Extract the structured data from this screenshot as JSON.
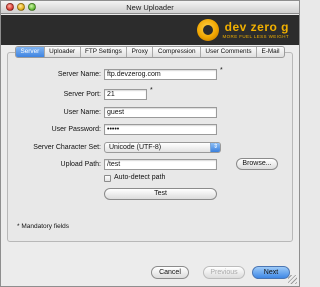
{
  "window": {
    "title": "New Uploader"
  },
  "banner": {
    "brand": "dev zero g",
    "tagline": "MORE FUEL LESS WEIGHT",
    "colors": {
      "background": "#2c2c2c",
      "accent": "#f1b000"
    }
  },
  "tabs": [
    {
      "label": "Server",
      "active": true
    },
    {
      "label": "Uploader",
      "active": false
    },
    {
      "label": "FTP Settings",
      "active": false
    },
    {
      "label": "Proxy",
      "active": false
    },
    {
      "label": "Compression",
      "active": false
    },
    {
      "label": "User Comments",
      "active": false
    },
    {
      "label": "E-Mail",
      "active": false
    }
  ],
  "form": {
    "server_name": {
      "label": "Server Name:",
      "value": "ftp.devzerog.com",
      "required_mark": "*"
    },
    "server_port": {
      "label": "Server Port:",
      "value": "21",
      "required_mark": "*"
    },
    "user_name": {
      "label": "User Name:",
      "value": "guest"
    },
    "user_password": {
      "label": "User Password:",
      "value": "•••••"
    },
    "charset": {
      "label": "Server Character Set:",
      "value": "Unicode (UTF-8)"
    },
    "upload_path": {
      "label": "Upload Path:",
      "value": "/test"
    },
    "browse_label": "Browse...",
    "auto_detect_label": "Auto-detect path",
    "test_label": "Test",
    "mandatory_note": "* Mandatory fields"
  },
  "footer": {
    "cancel_label": "Cancel",
    "previous_label": "Previous",
    "next_label": "Next"
  }
}
